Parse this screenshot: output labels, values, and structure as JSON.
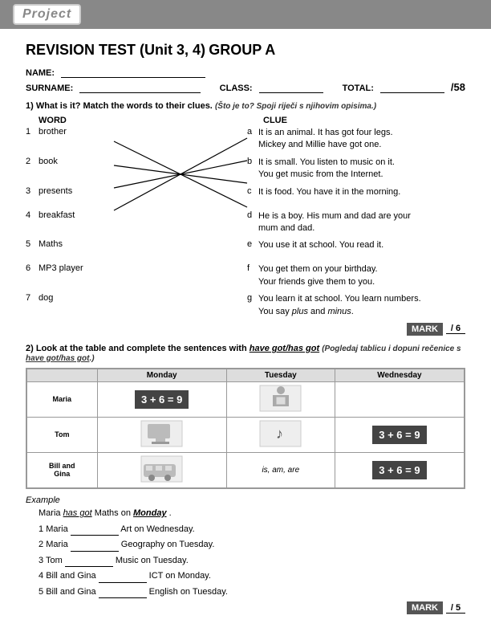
{
  "header": {
    "logo": "Project"
  },
  "test": {
    "title_prefix": "REVISION TEST (Unit 3, 4)",
    "title_main": "GROUP A",
    "name_label": "NAME:",
    "surname_label": "SURNAME:",
    "class_label": "CLASS:",
    "total_label": "TOTAL:",
    "total_score": "/58"
  },
  "q1": {
    "number": "1)",
    "instruction": "What is it? Match the words to their clues.",
    "instruction_native": "(Što je to? Spoji riječi s njihovim opisima.)",
    "word_header": "WORD",
    "clue_header": "CLUE",
    "items": [
      {
        "num": "1",
        "word": "brother",
        "letter": "a",
        "clue": "It is an animal. It has got four legs. Mickey and Millie have got one."
      },
      {
        "num": "2",
        "word": "book",
        "letter": "b",
        "clue": "It is small. You listen to music on it. You get music from the Internet."
      },
      {
        "num": "3",
        "word": "presents",
        "letter": "c",
        "clue": "It is food. You have it in the morning."
      },
      {
        "num": "4",
        "word": "breakfast",
        "letter": "d",
        "clue": "He is a boy. His mum and dad are your mum and dad."
      },
      {
        "num": "5",
        "word": "Maths",
        "letter": "e",
        "clue": "You use it at school. You read it."
      },
      {
        "num": "6",
        "word": "MP3 player",
        "letter": "f",
        "clue": "You get them on your birthday. Your friends give them to you."
      },
      {
        "num": "7",
        "word": "dog",
        "letter": "g",
        "clue": "You learn it at school. You learn numbers. You say plus and minus."
      }
    ],
    "mark_label": "MARK",
    "mark_score": "/ 6"
  },
  "q2": {
    "number": "2)",
    "instruction": "Look at the table and complete the sentences with",
    "have_got": "have got/has got",
    "instruction_native": "(Pogledaj tablicu i dopuni rečenice s have got/has got.)",
    "table": {
      "headers": [
        "",
        "Monday",
        "Tuesday",
        "Wednesday"
      ],
      "rows": [
        {
          "person": "Maria",
          "monday": "math_eq",
          "tuesday": "image",
          "wednesday": ""
        },
        {
          "person": "Tom",
          "monday": "image",
          "tuesday": "image",
          "wednesday": "math_eq"
        },
        {
          "person": "Bill and Gina",
          "monday": "image",
          "tuesday": "is_am_are",
          "wednesday": "math_eq"
        }
      ]
    },
    "example_label": "Example",
    "example_sentence": "Maria has got Maths on Monday .",
    "example_has": "has got",
    "example_maths": "Maths",
    "example_monday": "Monday",
    "sentences": [
      {
        "num": "1",
        "text": "Maria",
        "blank": "",
        "rest": "Art on Wednesday."
      },
      {
        "num": "2",
        "text": "Maria",
        "blank": "",
        "rest": "Geography on Tuesday."
      },
      {
        "num": "3",
        "text": "Tom",
        "blank": "",
        "rest": "Music on Tuesday."
      },
      {
        "num": "4",
        "text": "Bill and Gina",
        "blank": "",
        "rest": "ICT on Monday."
      },
      {
        "num": "5",
        "text": "Bill and Gina",
        "blank": "",
        "rest": "English on Tuesday."
      }
    ],
    "mark_label": "MARK",
    "mark_score": "/ 5"
  }
}
